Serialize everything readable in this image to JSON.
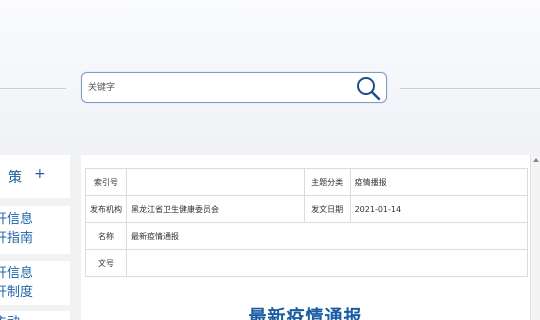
{
  "search": {
    "placeholder": "关键字"
  },
  "sidebar": {
    "header": {
      "label": "策",
      "plus": "+"
    },
    "cards": [
      {
        "lines": [
          "开信息",
          "开指南"
        ]
      },
      {
        "lines": [
          "开信息",
          "开制度"
        ]
      },
      {
        "lines": [
          "主动"
        ]
      }
    ]
  },
  "info": {
    "rows": [
      {
        "label1": "索引号",
        "value1": "",
        "label2": "主题分类",
        "value2": "疫情播报"
      },
      {
        "label1": "发布机构",
        "value1": "黑龙江省卫生健康委员会",
        "label2": "发文日期",
        "value2": "2021-01-14"
      },
      {
        "label1": "名称",
        "value1": "最新疫情通报",
        "label2": "",
        "value2": ""
      },
      {
        "label1": "文号",
        "value1": "",
        "label2": "",
        "value2": ""
      }
    ]
  },
  "article": {
    "title": "最新疫情通报"
  },
  "colors": {
    "accent": "#1d63a9",
    "border": "#7e9bc4"
  }
}
